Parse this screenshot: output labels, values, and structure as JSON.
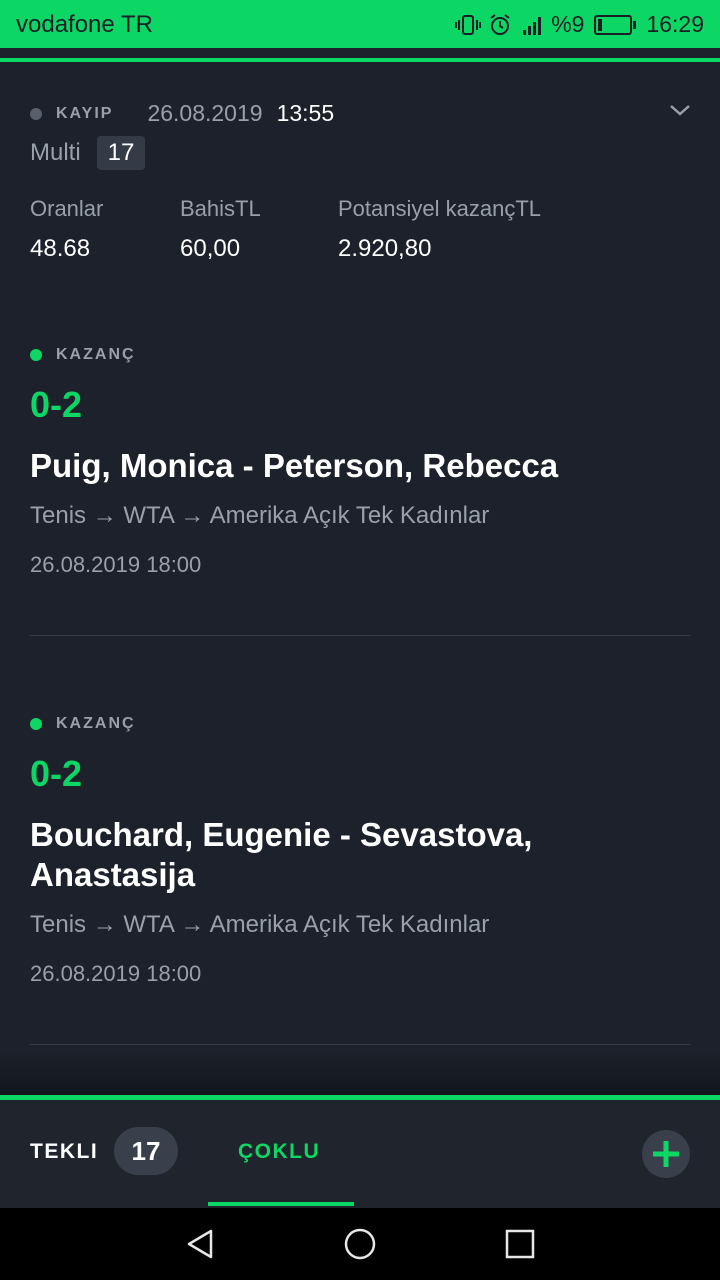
{
  "statusbar": {
    "carrier": "vodafone TR",
    "battery": "%9",
    "time": "16:29"
  },
  "bet": {
    "status": "KAYIP",
    "date": "26.08.2019",
    "time": "13:55",
    "type": "Multi",
    "count": "17",
    "odds_label": "Oranlar",
    "odds_value": "48.68",
    "stake_label": "BahisTL",
    "stake_value": "60,00",
    "potential_label": "Potansiyel kazançTL",
    "potential_value": "2.920,80"
  },
  "matches": [
    {
      "status": "KAZANÇ",
      "score": "0-2",
      "teams": "Puig, Monica - Peterson, Rebecca",
      "sport": "Tenis",
      "league": "WTA",
      "tournament": "Amerika Açık Tek Kadınlar",
      "date": "26.08.2019 18:00"
    },
    {
      "status": "KAZANÇ",
      "score": "0-2",
      "teams": "Bouchard, Eugenie - Sevastova, Anastasija",
      "sport": "Tenis",
      "league": "WTA",
      "tournament": "Amerika Açık Tek Kadınlar",
      "date": "26.08.2019 18:00"
    }
  ],
  "arrow": "→",
  "tabs": {
    "single_label": "TEKLI",
    "single_count": "17",
    "multi_label": "ÇOKLU"
  },
  "colors": {
    "accent": "#0cd664",
    "background": "#1c212b",
    "muted": "#9aa0aa"
  }
}
